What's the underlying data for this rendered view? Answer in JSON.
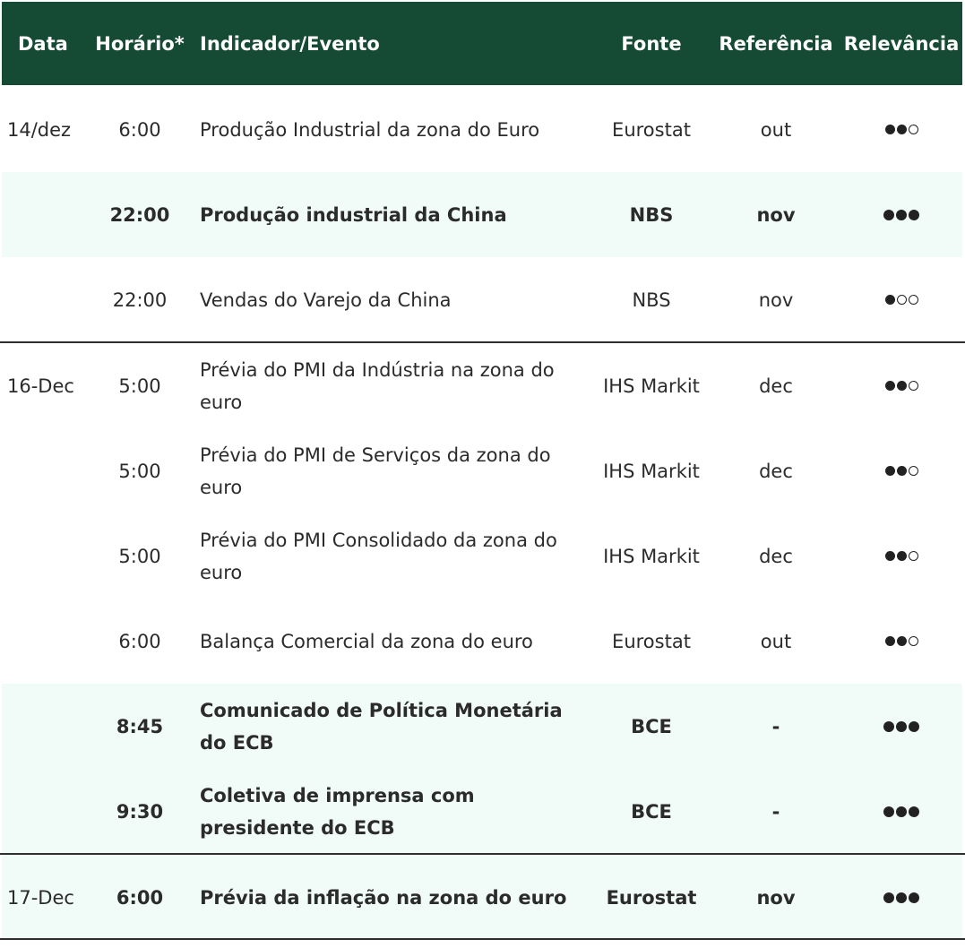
{
  "headers": {
    "date": "Data",
    "time": "Horário*",
    "event": "Indicador/Evento",
    "source": "Fonte",
    "reference": "Referência",
    "relevance": "Relevância"
  },
  "rows": [
    {
      "date": "14/dez",
      "time": "6:00",
      "event": "Produção Industrial da zona do Euro",
      "source": "Eurostat",
      "reference": "out",
      "relevance": 2
    },
    {
      "date": "",
      "time": "22:00",
      "event": "Produção industrial da China",
      "source": "NBS",
      "reference": "nov",
      "relevance": 3
    },
    {
      "date": "",
      "time": "22:00",
      "event": "Vendas do Varejo da China",
      "source": "NBS",
      "reference": "nov",
      "relevance": 1
    },
    {
      "date": "16-Dec",
      "time": "5:00",
      "event": "Prévia do PMI da Indústria na zona do euro",
      "source": "IHS Markit",
      "reference": "dec",
      "relevance": 2
    },
    {
      "date": "",
      "time": "5:00",
      "event": "Prévia do PMI de Serviços da zona do euro",
      "source": "IHS Markit",
      "reference": "dec",
      "relevance": 2
    },
    {
      "date": "",
      "time": "5:00",
      "event": "Prévia do PMI Consolidado da zona do euro",
      "source": "IHS Markit",
      "reference": "dec",
      "relevance": 2
    },
    {
      "date": "",
      "time": "6:00",
      "event": "Balança Comercial da zona do euro",
      "source": "Eurostat",
      "reference": "out",
      "relevance": 2
    },
    {
      "date": "",
      "time": "8:45",
      "event": "Comunicado de Política Monetária do ECB",
      "source": "BCE",
      "reference": "-",
      "relevance": 3
    },
    {
      "date": "",
      "time": "9:30",
      "event": "Coletiva de imprensa com presidente do ECB",
      "source": "BCE",
      "reference": "-",
      "relevance": 3
    },
    {
      "date": "17-Dec",
      "time": "6:00",
      "event": "Prévia da inflação na zona do euro",
      "source": "Eurostat",
      "reference": "nov",
      "relevance": 3
    }
  ],
  "relevance_max": 3
}
